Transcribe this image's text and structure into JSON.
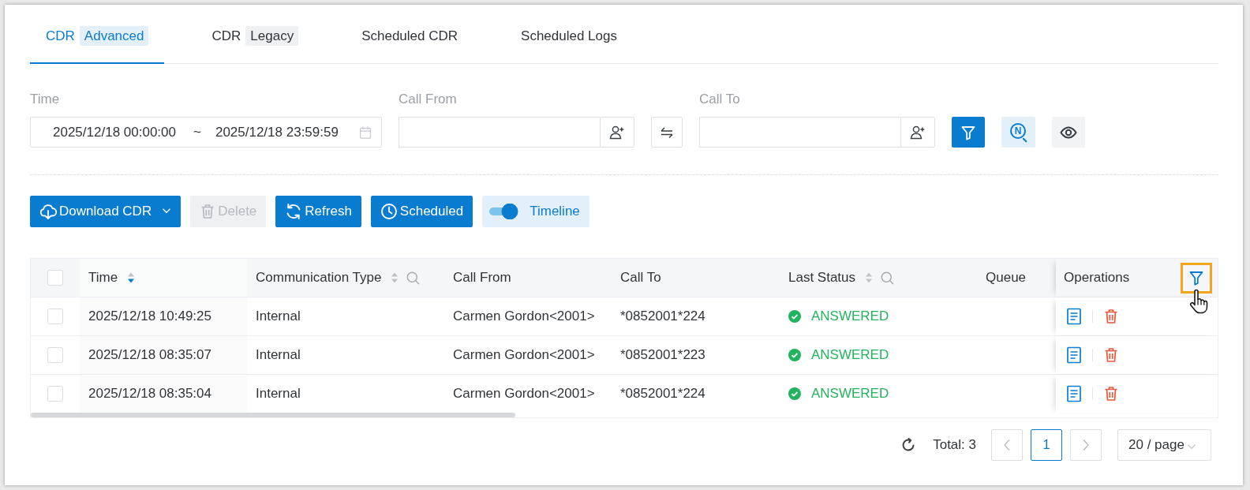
{
  "tabs": [
    {
      "label": "CDR",
      "badge": "Advanced",
      "selected": true
    },
    {
      "label": "CDR",
      "badge": "Legacy",
      "selected": false
    },
    {
      "label": "Scheduled CDR",
      "selected": false
    },
    {
      "label": "Scheduled Logs",
      "selected": false
    }
  ],
  "filters": {
    "time": {
      "label": "Time",
      "start": "2025/12/18 00:00:00",
      "separator": "~",
      "end": "2025/12/18 23:59:59"
    },
    "call_from": {
      "label": "Call From"
    },
    "call_to": {
      "label": "Call To"
    },
    "advanced_search": {
      "glyph": "N"
    }
  },
  "toolbar": {
    "buttons": [
      {
        "kind": "download",
        "label": "Download CDR",
        "disabled": false
      },
      {
        "kind": "delete",
        "label": "Delete",
        "disabled": true
      },
      {
        "kind": "refresh",
        "label": "Refresh",
        "disabled": false
      },
      {
        "kind": "schedule",
        "label": "Scheduled",
        "disabled": false
      }
    ],
    "timeline": {
      "label": "Timeline",
      "on": true
    }
  },
  "table": {
    "all_checked": false,
    "columns": [
      {
        "label": "Time",
        "sortable": true,
        "sorted": true
      },
      {
        "label": "Communication Type",
        "sortable": true,
        "sorted": false,
        "searchable": true
      },
      {
        "label": "Call From"
      },
      {
        "label": "Call To"
      },
      {
        "label": "Last Status",
        "sortable": true,
        "sorted": false,
        "searchable": true
      },
      {
        "label": "Queue"
      },
      {
        "label": "Operations",
        "filterable": true
      }
    ],
    "rows": [
      {
        "checked": false,
        "time": "2025/12/18 10:49:25",
        "type": "Internal",
        "call_from": "Carmen Gordon<2001>",
        "call_to": "*0852001*224",
        "status": {
          "kind": "answered",
          "text": "ANSWERED"
        }
      },
      {
        "checked": false,
        "time": "2025/12/18 08:35:07",
        "type": "Internal",
        "call_from": "Carmen Gordon<2001>",
        "call_to": "*0852001*223",
        "status": {
          "kind": "answered",
          "text": "ANSWERED"
        }
      },
      {
        "checked": false,
        "time": "2025/12/18 08:35:04",
        "type": "Internal",
        "call_from": "Carmen Gordon<2001>",
        "call_to": "*0852001*224",
        "status": {
          "kind": "answered",
          "text": "ANSWERED"
        }
      }
    ]
  },
  "pagination": {
    "total": "Total: 3",
    "pages": [
      {
        "label": "1",
        "selected": true
      }
    ],
    "page_size": "20 / page"
  }
}
